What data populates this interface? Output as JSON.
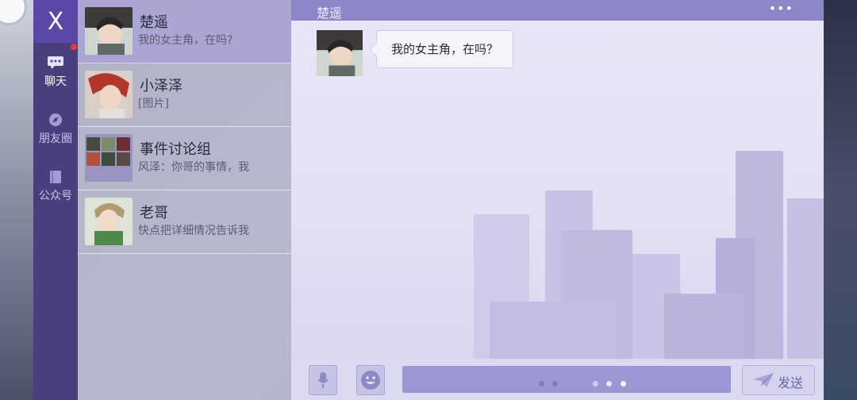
{
  "nav": {
    "close_label": "X",
    "items": [
      {
        "label": "聊天",
        "icon": "chat-icon",
        "active": true
      },
      {
        "label": "朋友圈",
        "icon": "compass-icon",
        "active": false
      },
      {
        "label": "公众号",
        "icon": "book-icon",
        "active": false
      }
    ]
  },
  "chats": [
    {
      "name": "楚遥",
      "preview": "我的女主角，在吗?",
      "avatar": "avatar-chuyao",
      "selected": true
    },
    {
      "name": "小泽泽",
      "preview": "[图片]",
      "avatar": "avatar-xiaozeze",
      "selected": false
    },
    {
      "name": "事件讨论组",
      "preview": "风泽：你哥的事情，我",
      "avatar": "avatar-group",
      "selected": false
    },
    {
      "name": "老哥",
      "preview": "快点把详细情况告诉我",
      "avatar": "avatar-laoge",
      "selected": false
    }
  ],
  "conversation": {
    "title": "楚遥",
    "more_label": "•••",
    "messages": [
      {
        "sender": "楚遥",
        "text": "我的女主角，在吗？"
      }
    ]
  },
  "composer": {
    "send_label": "发送",
    "voice_icon": "microphone-icon",
    "emoji_icon": "smiley-icon"
  },
  "colors": {
    "nav_bg": "#4a3f7d",
    "accent": "#8b86c7",
    "selected_row": "#aaa5d2",
    "unread_dot": "#e23b3b"
  }
}
